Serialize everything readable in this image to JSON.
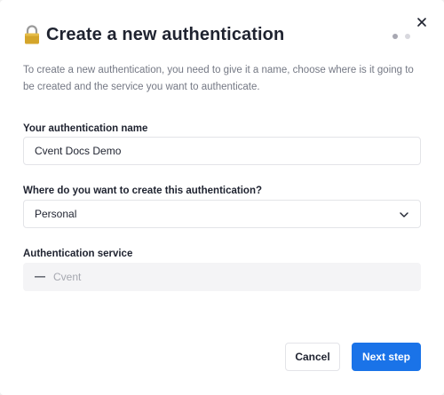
{
  "dialog": {
    "title": "Create a new authentication",
    "description": "To create a new authentication, you need to give it a name, choose where is it going to be created and the service you want to authenticate.",
    "step_count": 2,
    "current_step": 1
  },
  "form": {
    "name_label": "Your authentication name",
    "name_value": "Cvent Docs Demo",
    "location_label": "Where do you want to create this authentication?",
    "location_value": "Personal",
    "service_label": "Authentication service",
    "service_value": "Cvent"
  },
  "buttons": {
    "cancel": "Cancel",
    "next": "Next step"
  },
  "colors": {
    "primary": "#1a73e8",
    "lock": "#c9a227"
  }
}
